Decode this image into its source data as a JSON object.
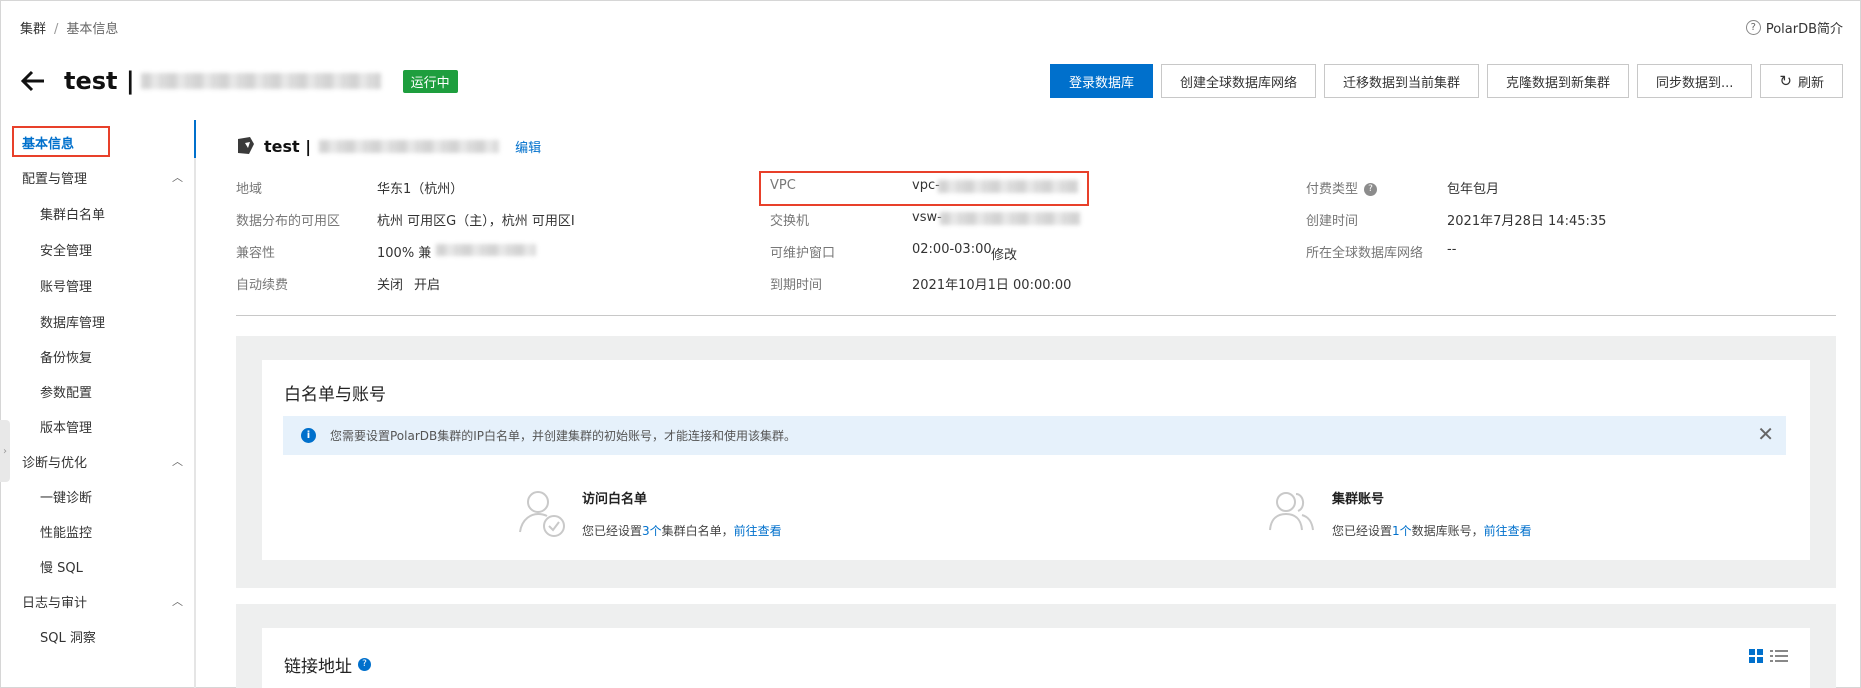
{
  "breadcrumb": {
    "root": "集群",
    "separator": "/",
    "current": "基本信息"
  },
  "help": {
    "icon": "question-circle-icon",
    "label": "PolarDB简介"
  },
  "header": {
    "title_prefix": "test |",
    "status": "运行中",
    "status_color": "#1e9e3e"
  },
  "toolbar": {
    "login_db": "登录数据库",
    "create_global": "创建全球数据库网络",
    "migrate": "迁移数据到当前集群",
    "clone": "克隆数据到新集群",
    "sync": "同步数据到...",
    "refresh": "刷新"
  },
  "sidebar": {
    "active": "基本信息",
    "groups": [
      {
        "label": "配置与管理",
        "items": [
          "集群白名单",
          "安全管理",
          "账号管理",
          "数据库管理",
          "备份恢复",
          "参数配置",
          "版本管理"
        ]
      },
      {
        "label": "诊断与优化",
        "items": [
          "一键诊断",
          "性能监控",
          "慢 SQL"
        ]
      },
      {
        "label": "日志与审计",
        "items": [
          "SQL 洞察"
        ]
      }
    ]
  },
  "info": {
    "name": "test |",
    "edit": "编辑",
    "col1": [
      {
        "label": "地域",
        "value": "华东1（杭州）"
      },
      {
        "label": "数据分布的可用区",
        "value": "杭州 可用区G（主），杭州 可用区I"
      },
      {
        "label": "兼容性",
        "value": "100% 兼"
      },
      {
        "label": "自动续费",
        "value": "关闭",
        "link": "开启"
      }
    ],
    "col2": [
      {
        "label": "VPC",
        "value": "vpc-"
      },
      {
        "label": "交换机",
        "value": "vsw-"
      },
      {
        "label": "可维护窗口",
        "value": "02:00-03:00",
        "link": "修改"
      },
      {
        "label": "到期时间",
        "value": "2021年10月1日 00:00:00"
      }
    ],
    "col3": [
      {
        "label": "付费类型",
        "value": "包年包月"
      },
      {
        "label": "创建时间",
        "value": "2021年7月28日 14:45:35"
      },
      {
        "label": "所在全球数据库网络",
        "value": "--"
      }
    ]
  },
  "whitelist_panel": {
    "title": "白名单与账号",
    "alert": "您需要设置PolarDB集群的IP白名单，并创建集群的初始账号，才能连接和使用该集群。",
    "whitelist": {
      "title": "访问白名单",
      "pre": "您已经设置",
      "count": "3个",
      "mid": "集群白名单，",
      "link": "前往查看"
    },
    "accounts": {
      "title": "集群账号",
      "pre": "您已经设置",
      "count": "1个",
      "mid": "数据库账号，",
      "link": "前往查看"
    }
  },
  "connection_panel": {
    "title": "链接地址"
  }
}
